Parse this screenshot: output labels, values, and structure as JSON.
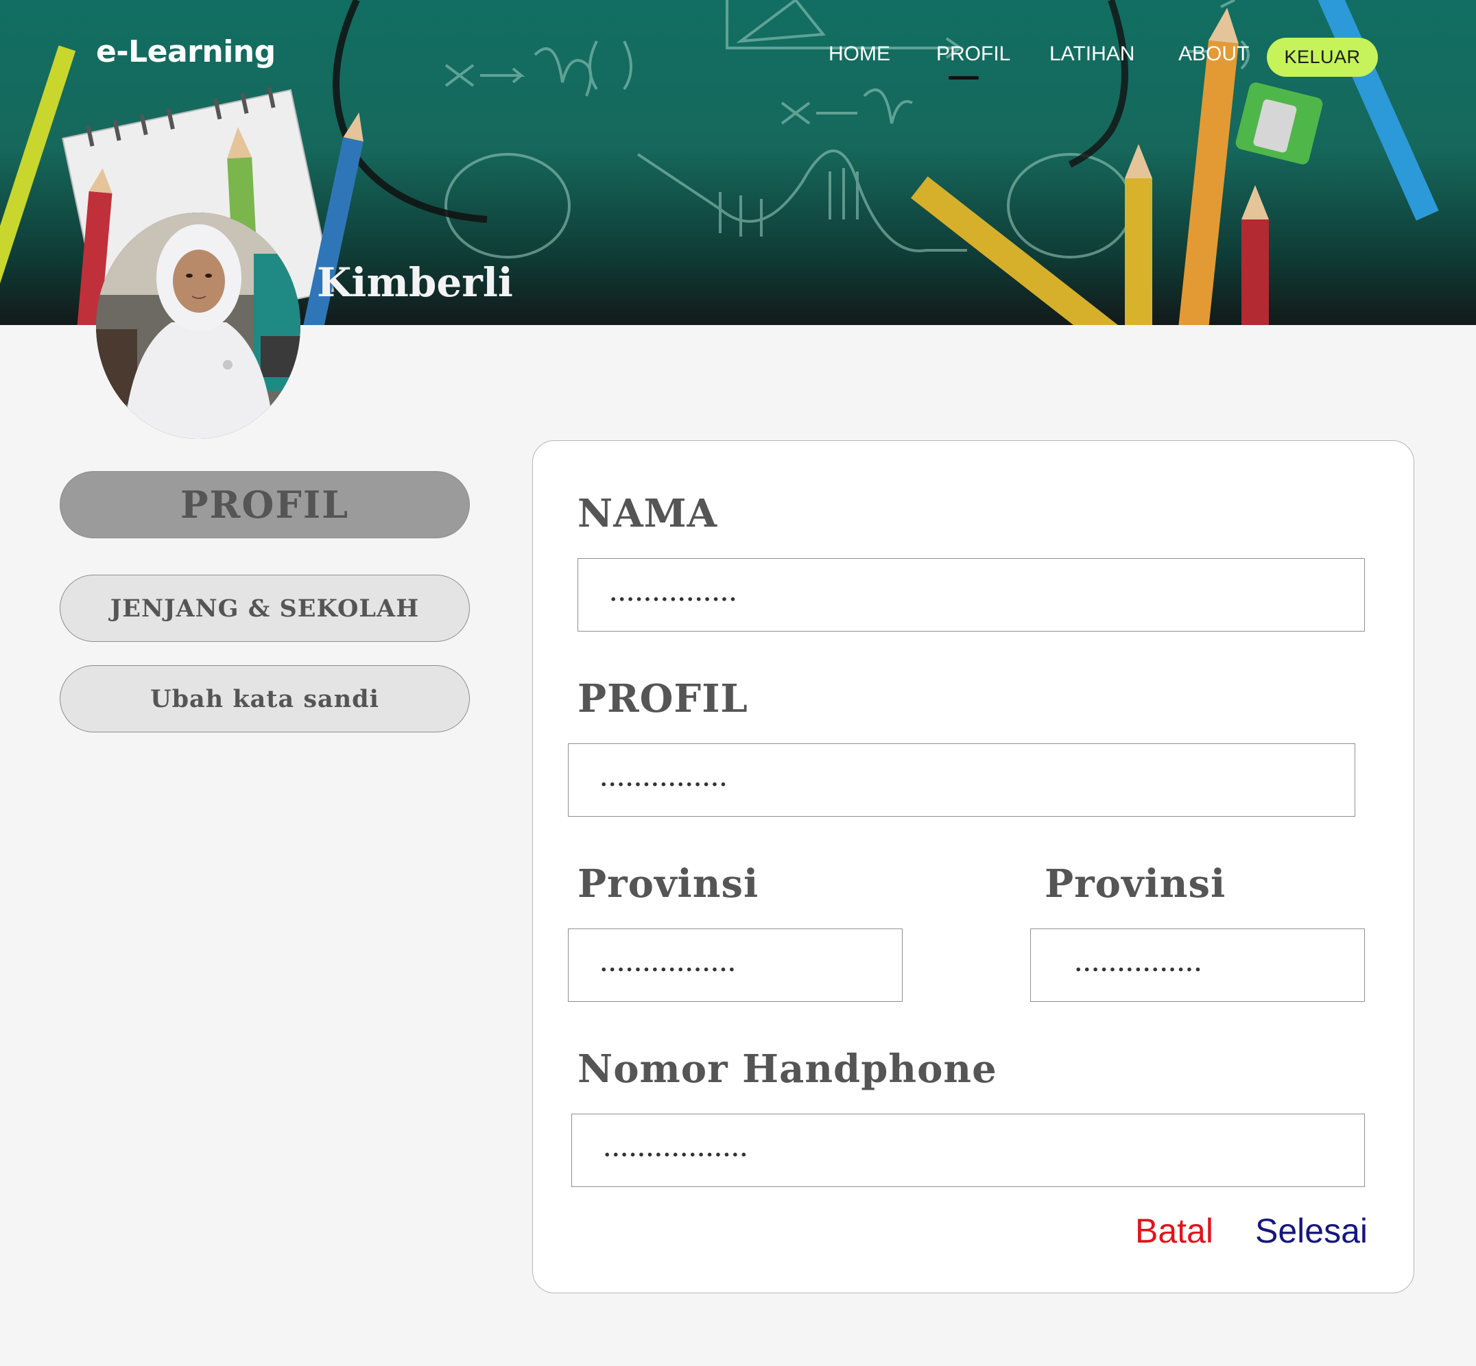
{
  "header": {
    "brand": "e-Learning",
    "nav": [
      {
        "label": "HOME",
        "active": false
      },
      {
        "label": "PROFIL",
        "active": true
      },
      {
        "label": "LATIHAN",
        "active": false
      },
      {
        "label": "ABOUT",
        "active": false
      }
    ],
    "logout_label": "KELUAR",
    "logout_color": "#c6f35a"
  },
  "profile": {
    "name": "Kimberli"
  },
  "sidebar": {
    "items": [
      {
        "label": "PROFIL",
        "active": true
      },
      {
        "label": "JENJANG & SEKOLAH",
        "active": false
      },
      {
        "label": "Ubah kata sandi",
        "active": false
      }
    ]
  },
  "form": {
    "fields": [
      {
        "label": "NAMA",
        "value": "..............."
      },
      {
        "label": "PROFIL",
        "value": "..............."
      },
      {
        "label": "Provinsi",
        "value": "................"
      },
      {
        "label": "Provinsi",
        "value": "..............."
      },
      {
        "label": "Nomor Handphone",
        "value": "................."
      }
    ],
    "cancel_label": "Batal",
    "cancel_color": "#e0141b",
    "submit_label": "Selesai",
    "submit_color": "#161680"
  }
}
